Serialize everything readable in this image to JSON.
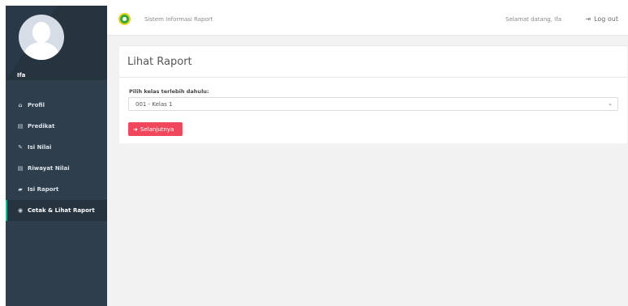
{
  "sidebar": {
    "username": "Ifa",
    "items": [
      {
        "label": "Profil",
        "icon": "home-icon",
        "glyph": "⌂"
      },
      {
        "label": "Predikat",
        "icon": "table-icon",
        "glyph": "▤"
      },
      {
        "label": "Isi Nilai",
        "icon": "pencil-icon",
        "glyph": "✎"
      },
      {
        "label": "Riwayat Nilai",
        "icon": "table-icon",
        "glyph": "▤"
      },
      {
        "label": "Isi Raport",
        "icon": "book-icon",
        "glyph": "▰"
      },
      {
        "label": "Cetak & Lihat Raport",
        "icon": "eye-icon",
        "glyph": "◉"
      }
    ],
    "active_index": 5
  },
  "topbar": {
    "app_title": "Sistem Informasi Raport",
    "welcome": "Selamat datang, Ifa",
    "logout_label": "Log out",
    "logout_icon": "⇥"
  },
  "main": {
    "title": "Lihat Raport",
    "field_label": "Pilih kelas terlebih dahulu:",
    "selected_class": "001 - Kelas 1",
    "chevron": "⌄",
    "next_button": "Selanjutnya",
    "next_icon": "➜"
  },
  "colors": {
    "sidebar_bg": "#2f3e4c",
    "active_indicator": "#19b394",
    "button_bg": "#f0475d",
    "page_bg": "#f2f2f2"
  }
}
